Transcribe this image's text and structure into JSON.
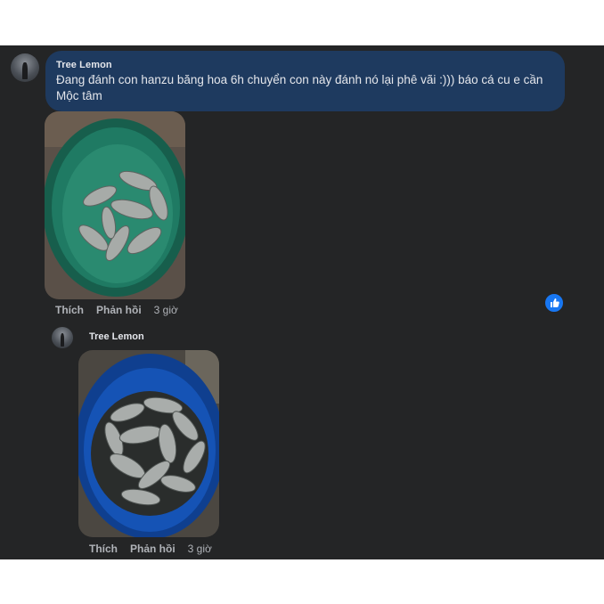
{
  "comment": {
    "author": "Tree Lemon",
    "text": "Đang đánh con hanzu băng hoa 6h chuyển con này đánh nó lại phê vãi :))) báo cá cu e cần Mộc tâm",
    "actions": {
      "like": "Thích",
      "reply": "Phản hồi",
      "time": "3 giờ"
    }
  },
  "reply": {
    "author": "Tree Lemon",
    "actions": {
      "like": "Thích",
      "reply": "Phản hồi",
      "time": "3 giờ"
    }
  },
  "colors": {
    "panel": "#242526",
    "bubble": "#1e3a5f",
    "like_badge": "#1877f2",
    "green_basin": "#1f7a63",
    "blue_bucket": "#1553b5"
  },
  "icons": {
    "reaction": "thumbs-up-icon"
  }
}
